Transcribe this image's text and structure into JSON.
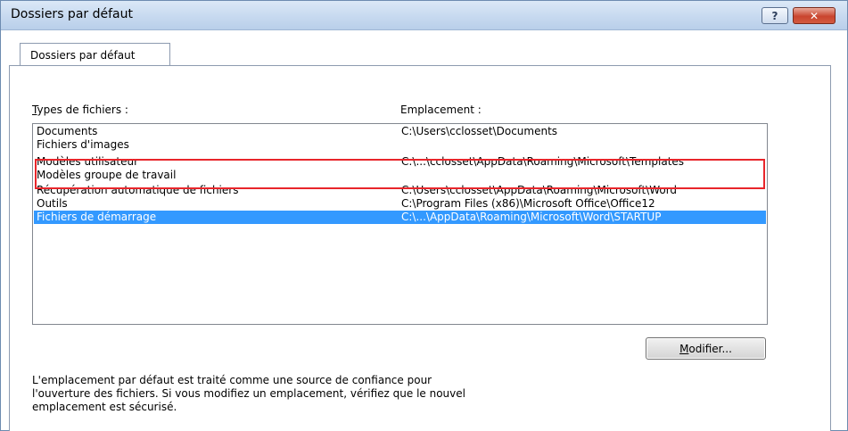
{
  "window": {
    "title": "Dossiers par défaut",
    "help_label": "?",
    "close_label": "✕"
  },
  "tab": {
    "label": "Dossiers par défaut"
  },
  "columns": {
    "types_prefix": "T",
    "types_rest": "ypes de fichiers :",
    "location": "Emplacement :"
  },
  "rows": [
    {
      "type": "Documents",
      "path": "C:\\Users\\cclosset\\Documents",
      "selected": false
    },
    {
      "type": "Fichiers d'images",
      "path": "",
      "selected": false
    },
    {
      "type": "Modèles utilisateur",
      "path": "C:\\...\\cclosset\\AppData\\Roaming\\Microsoft\\Templates",
      "selected": false
    },
    {
      "type": "Modèles groupe de travail",
      "path": "",
      "selected": false
    },
    {
      "type": "Récupération automatique de fichiers",
      "path": "C:\\Users\\cclosset\\AppData\\Roaming\\Microsoft\\Word",
      "selected": false
    },
    {
      "type": "Outils",
      "path": "C:\\Program Files (x86)\\Microsoft Office\\Office12",
      "selected": false
    },
    {
      "type": "Fichiers de démarrage",
      "path": "C:\\...\\AppData\\Roaming\\Microsoft\\Word\\STARTUP",
      "selected": true
    }
  ],
  "modify_button": {
    "prefix": "M",
    "rest": "odifier..."
  },
  "info_lines": [
    "L'emplacement par défaut est traité comme une source de confiance pour",
    "l'ouverture des fichiers. Si vous modifiez un emplacement, vérifiez que le nouvel",
    "emplacement est sécurisé."
  ],
  "colors": {
    "selection": "#3399ff",
    "highlight_border": "#e8262b"
  }
}
